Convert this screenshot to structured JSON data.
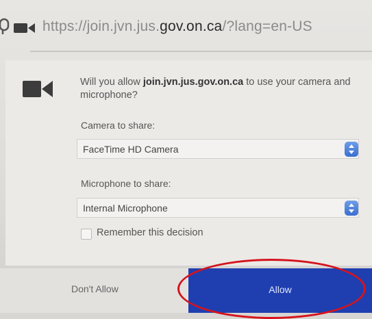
{
  "url_bar": {
    "url_prefix": "https://join.jvn.jus.",
    "url_domain": "gov.on.ca",
    "url_suffix": "/?lang=en-US"
  },
  "dialog": {
    "question_lead": "Will you allow ",
    "question_site": "join.jvn.jus.gov.on.ca",
    "question_tail": " to use your camera and microphone?",
    "camera_label": "Camera to share:",
    "camera_value": "FaceTime HD Camera",
    "microphone_label": "Microphone to share:",
    "microphone_value": "Internal Microphone",
    "remember_label": "Remember this decision",
    "remember_checked": false,
    "deny_label": "Don't Allow",
    "allow_label": "Allow"
  },
  "icons": {
    "microphone": "microphone-icon",
    "camera": "video-camera-icon",
    "select_arrows": "updown-chevron-icon"
  },
  "colors": {
    "allow_button": "#1f3fb0",
    "select_arrow": "#3a6fd0",
    "highlight_ring": "#d5141d"
  }
}
